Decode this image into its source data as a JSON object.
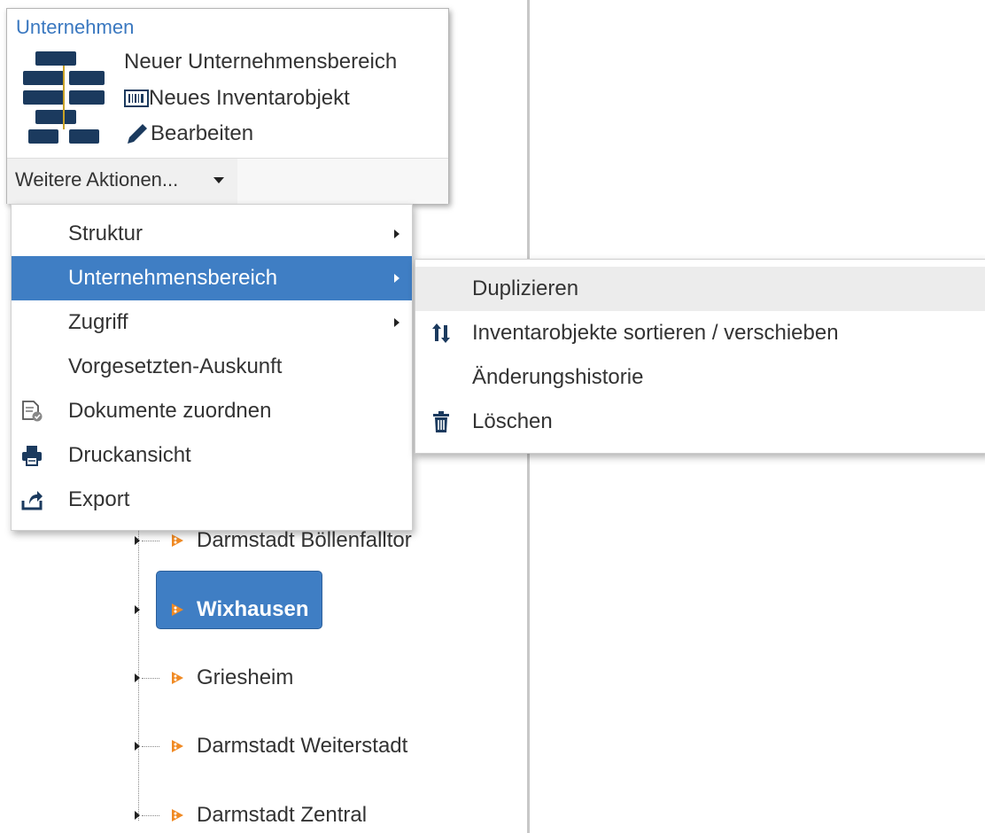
{
  "card": {
    "title": "Unternehmen",
    "actions": [
      {
        "label": "Neuer Unternehmensbereich",
        "icon": "none"
      },
      {
        "label": "Neues Inventarobjekt",
        "icon": "barcode-icon"
      },
      {
        "label": "Bearbeiten",
        "icon": "pencil-icon"
      }
    ],
    "more_actions_label": "Weitere Aktionen..."
  },
  "menu": {
    "items": [
      {
        "label": "Struktur",
        "submenu": true
      },
      {
        "label": "Unternehmensbereich",
        "submenu": true,
        "active": true
      },
      {
        "label": "Zugriff",
        "submenu": true
      },
      {
        "label": "Vorgesetzten-Auskunft",
        "submenu": false
      },
      {
        "label": "Dokumente zuordnen",
        "icon": "document-assign-icon"
      },
      {
        "label": "Druckansicht",
        "icon": "printer-icon"
      },
      {
        "label": "Export",
        "icon": "export-icon"
      }
    ]
  },
  "submenu": {
    "items": [
      {
        "label": "Duplizieren",
        "hover": true
      },
      {
        "label": "Inventarobjekte sortieren / verschieben",
        "icon": "sort-icon"
      },
      {
        "label": "Änderungshistorie"
      },
      {
        "label": "Löschen",
        "icon": "trash-icon"
      }
    ]
  },
  "tree": {
    "nodes": [
      {
        "label": "Darmstadt Böllenfalltor"
      },
      {
        "label": "Wixhausen",
        "selected": true
      },
      {
        "label": "Griesheim"
      },
      {
        "label": "Darmstadt Weiterstadt"
      },
      {
        "label": "Darmstadt Zentral"
      }
    ]
  },
  "colors": {
    "accent": "#3f7ec4",
    "title_blue": "#3a78c0",
    "icon_dark": "#1b3a5e",
    "node_icon_orange": "#f08a24"
  }
}
